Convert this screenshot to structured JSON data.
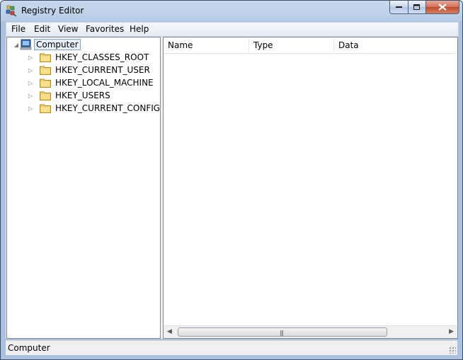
{
  "window": {
    "title": "Registry Editor"
  },
  "menu": [
    {
      "label": "File"
    },
    {
      "label": "Edit"
    },
    {
      "label": "View"
    },
    {
      "label": "Favorites"
    },
    {
      "label": "Help"
    }
  ],
  "tree": {
    "root_label": "Computer",
    "hives": [
      {
        "label": "HKEY_CLASSES_ROOT"
      },
      {
        "label": "HKEY_CURRENT_USER"
      },
      {
        "label": "HKEY_LOCAL_MACHINE"
      },
      {
        "label": "HKEY_USERS"
      },
      {
        "label": "HKEY_CURRENT_CONFIG"
      }
    ]
  },
  "list": {
    "columns": [
      {
        "label": "Name"
      },
      {
        "label": "Type"
      },
      {
        "label": "Data"
      }
    ],
    "rows": []
  },
  "status": {
    "text": "Computer"
  },
  "colors": {
    "title_bg": "#b9d1ea",
    "close_button": "#c7472f",
    "selection_border": "#7da2ce"
  }
}
